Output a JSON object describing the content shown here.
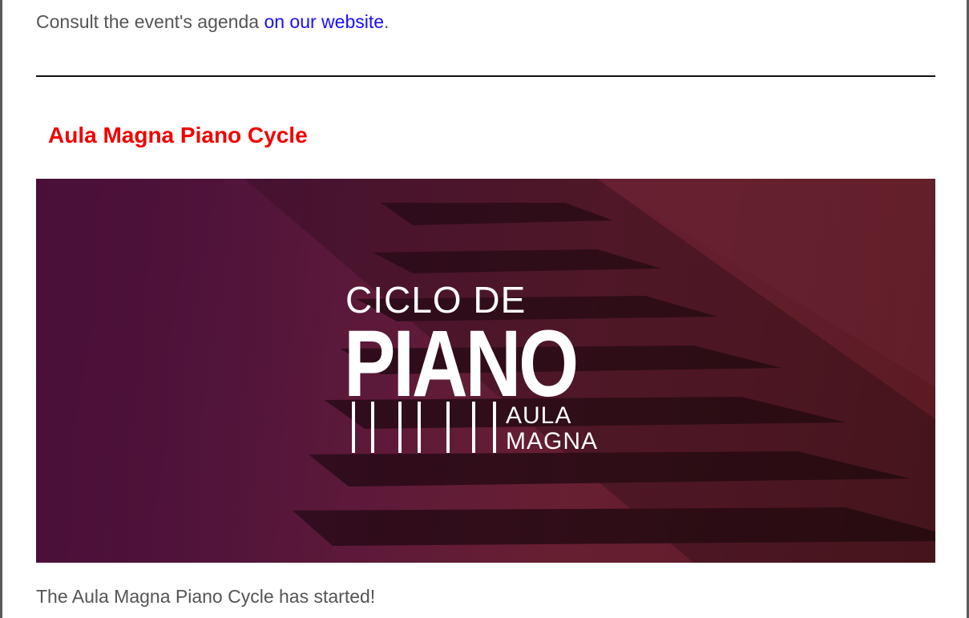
{
  "intro": {
    "prefix": "Consult the event's agenda ",
    "link_text": "on our website",
    "suffix": "."
  },
  "section": {
    "title": "Aula Magna Piano Cycle"
  },
  "banner": {
    "logo_line1": "CICLO DE",
    "logo_line2": "PIANO",
    "logo_line3": "AULA",
    "logo_line4": "MAGNA"
  },
  "caption": "The Aula Magna Piano Cycle has started!",
  "colors": {
    "title_red": "#f20000",
    "link_blue": "#1a0dff",
    "body_text": "#555555"
  }
}
